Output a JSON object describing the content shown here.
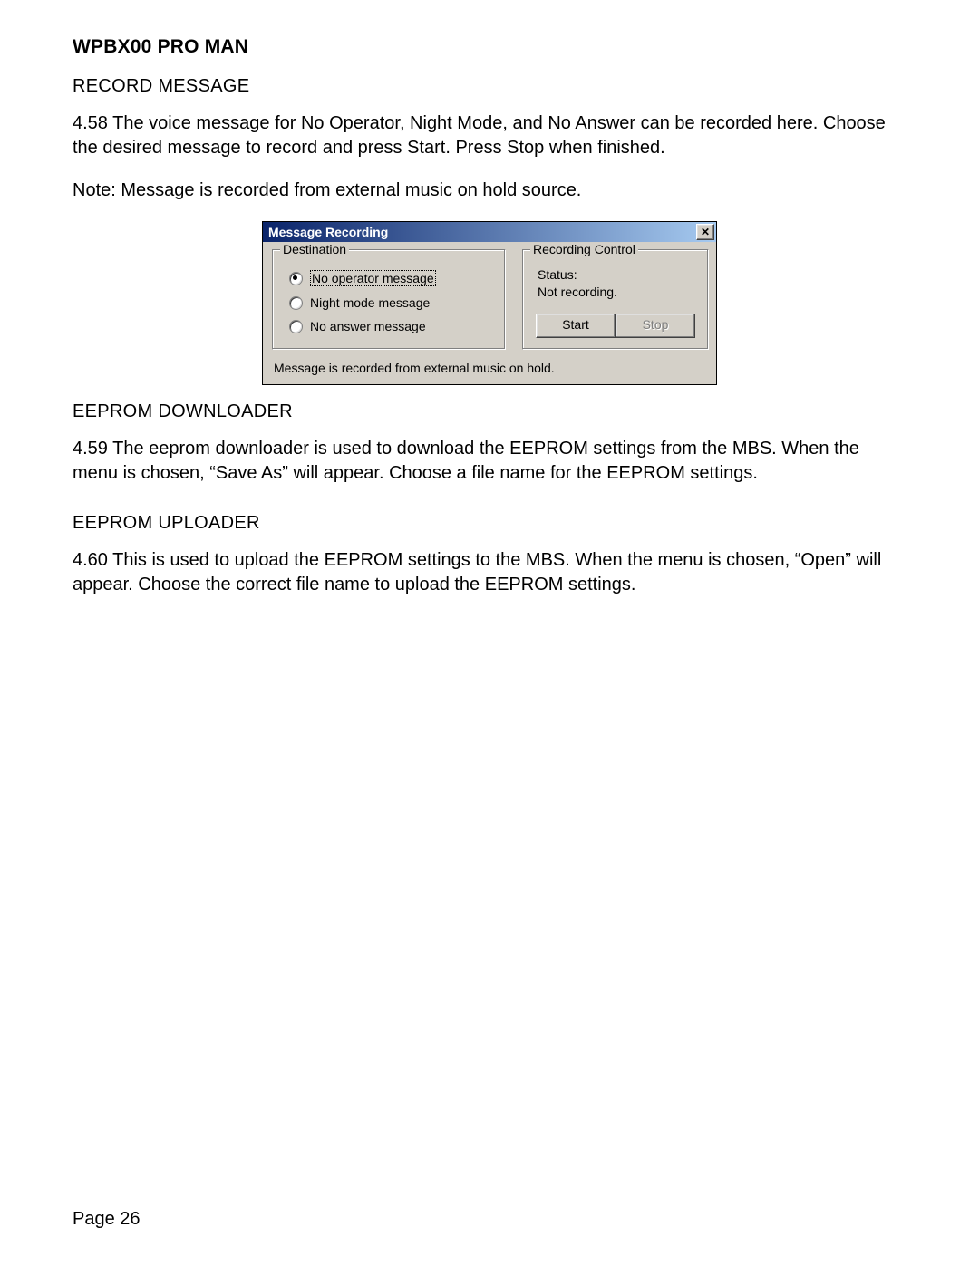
{
  "header": {
    "title": "WPBX00 PRO MAN"
  },
  "sections": {
    "record": {
      "heading": "RECORD MESSAGE",
      "para1": "4.58    The voice message for No Operator, Night Mode, and No Answer can be recorded here.  Choose the desired message to record and press Start.  Press Stop when finished.",
      "para2": "Note:  Message is recorded from external music on hold source."
    },
    "downloader": {
      "heading": "EEPROM DOWNLOADER",
      "para": "4.59    The eeprom downloader is used to download the EEPROM settings from the MBS.  When the menu is chosen,  “Save As” will appear.  Choose a file name for the EEPROM settings."
    },
    "uploader": {
      "heading": "EEPROM UPLOADER",
      "para": "4.60    This is used to upload the EEPROM settings to the MBS.  When the menu is chosen, “Open” will appear.  Choose the correct file name to upload the EEPROM settings."
    }
  },
  "dialog": {
    "title": "Message Recording",
    "close_glyph": "✕",
    "destination": {
      "legend": "Destination",
      "options": {
        "no_operator": "No operator message",
        "night_mode": "Night mode message",
        "no_answer": "No answer message"
      },
      "selected": "no_operator"
    },
    "recording": {
      "legend": "Recording Control",
      "status_label": "Status:",
      "status_value": "Not recording.",
      "start_label": "Start",
      "stop_label": "Stop"
    },
    "footer": "Message is recorded from external music on hold."
  },
  "page_number": "Page 26"
}
